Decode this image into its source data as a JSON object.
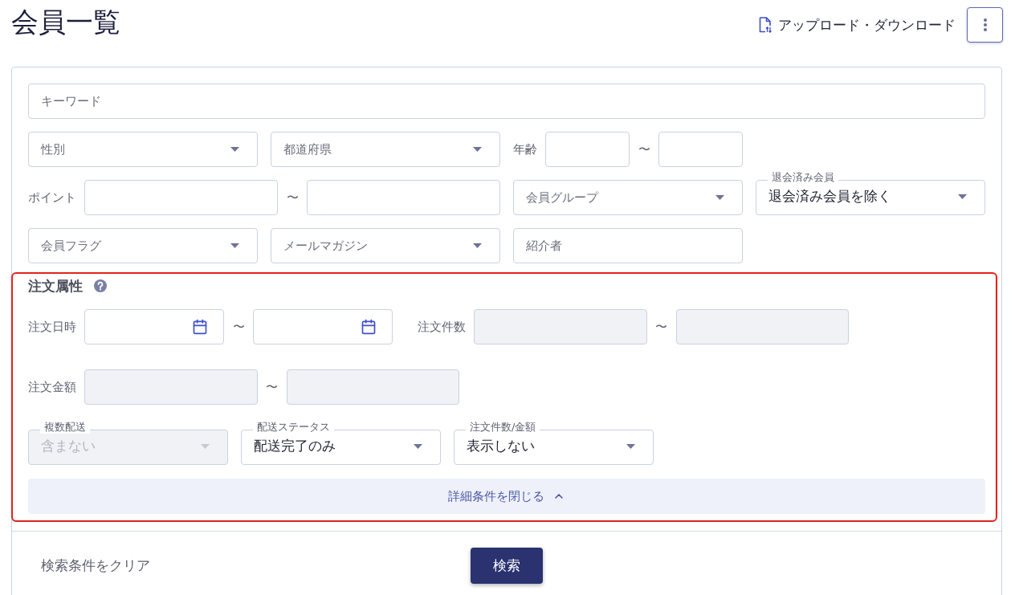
{
  "header": {
    "title": "会員一覧",
    "upload_download_link": "アップロード・ダウンロード"
  },
  "search_panel": {
    "keyword": {
      "placeholder": "キーワード"
    },
    "gender": {
      "placeholder": "性別"
    },
    "prefecture": {
      "placeholder": "都道府県"
    },
    "age": {
      "label": "年齢",
      "separator": "〜"
    },
    "points": {
      "label": "ポイント",
      "separator": "〜"
    },
    "member_group": {
      "placeholder": "会員グループ"
    },
    "withdrawn_members": {
      "label": "退会済み会員",
      "value": "退会済み会員を除く"
    },
    "member_flag": {
      "placeholder": "会員フラグ"
    },
    "mail_magazine": {
      "placeholder": "メールマガジン"
    },
    "referrer": {
      "placeholder": "紹介者"
    },
    "order_attributes": {
      "title": "注文属性",
      "expanded": true,
      "order_date": {
        "label": "注文日時",
        "separator": "〜",
        "inputs": [
          {
            "disabled": false
          },
          {
            "disabled": false
          }
        ]
      },
      "order_count": {
        "label": "注文件数",
        "separator": "〜",
        "inputs": [
          {
            "disabled": true
          },
          {
            "disabled": true
          }
        ]
      },
      "order_amount": {
        "label": "注文金額",
        "separator": "〜",
        "inputs": [
          {
            "disabled": true
          },
          {
            "disabled": true
          }
        ]
      },
      "selects": [
        {
          "label": "複数配送",
          "value": "含まない",
          "disabled": true
        },
        {
          "label": "配送ステータス",
          "value": "配送完了のみ",
          "disabled": false
        },
        {
          "label": "注文件数/金額",
          "value": "表示しない",
          "disabled": false
        }
      ],
      "toggle_label": "詳細条件を閉じる"
    },
    "actions": {
      "clear_button": "検索条件をクリア",
      "search_button": "検索"
    }
  }
}
